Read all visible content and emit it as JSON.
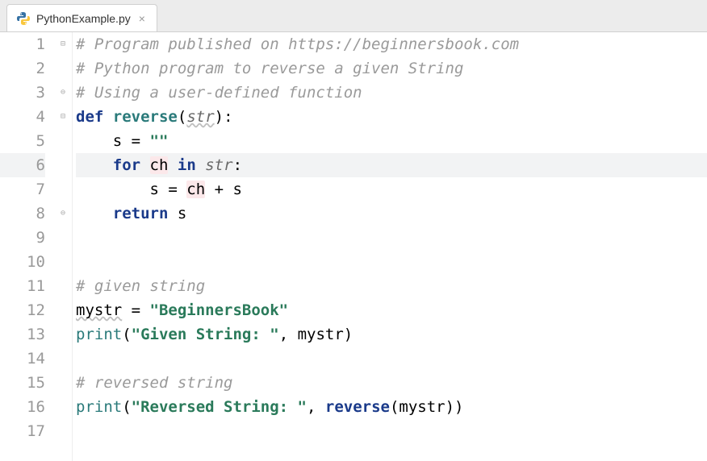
{
  "tab": {
    "filename": "PythonExample.py",
    "close_glyph": "×"
  },
  "editor": {
    "line_count": 17,
    "highlighted_line": 6,
    "highlighted_var": "ch",
    "fold_markers": [
      {
        "line": 1,
        "type": "open"
      },
      {
        "line": 3,
        "type": "close"
      },
      {
        "line": 4,
        "type": "open"
      },
      {
        "line": 8,
        "type": "close"
      }
    ],
    "lines": {
      "l1": "# Program published on https://beginnersbook.com",
      "l2": "# Python program to reverse a given String",
      "l3": "# Using a user-defined function",
      "l4_def": "def",
      "l4_fn": "reverse",
      "l4_paren_open": "(",
      "l4_param": "str",
      "l4_paren_close": "):",
      "l5_pre": "    s = ",
      "l5_str": "\"\"",
      "l6_for": "for",
      "l6_ch": "ch",
      "l6_in": "in",
      "l6_str": "str",
      "l6_colon": ":",
      "l7_pre": "        s = ",
      "l7_ch": "ch",
      "l7_post": " + s",
      "l8_ret": "return",
      "l8_var": " s",
      "l11": "# given string",
      "l12_var": "mystr",
      "l12_eq": " = ",
      "l12_str": "\"BeginnersBook\"",
      "l13_fn": "print",
      "l13_open": "(",
      "l13_str": "\"Given String: \"",
      "l13_rest": ", mystr)",
      "l15": "# reversed string",
      "l16_fn": "print",
      "l16_open": "(",
      "l16_str": "\"Reversed String: \"",
      "l16_sep": ", ",
      "l16_call": "reverse",
      "l16_rest": "(mystr))"
    },
    "gutter": [
      "1",
      "2",
      "3",
      "4",
      "5",
      "6",
      "7",
      "8",
      "9",
      "10",
      "11",
      "12",
      "13",
      "14",
      "15",
      "16",
      "17"
    ]
  }
}
